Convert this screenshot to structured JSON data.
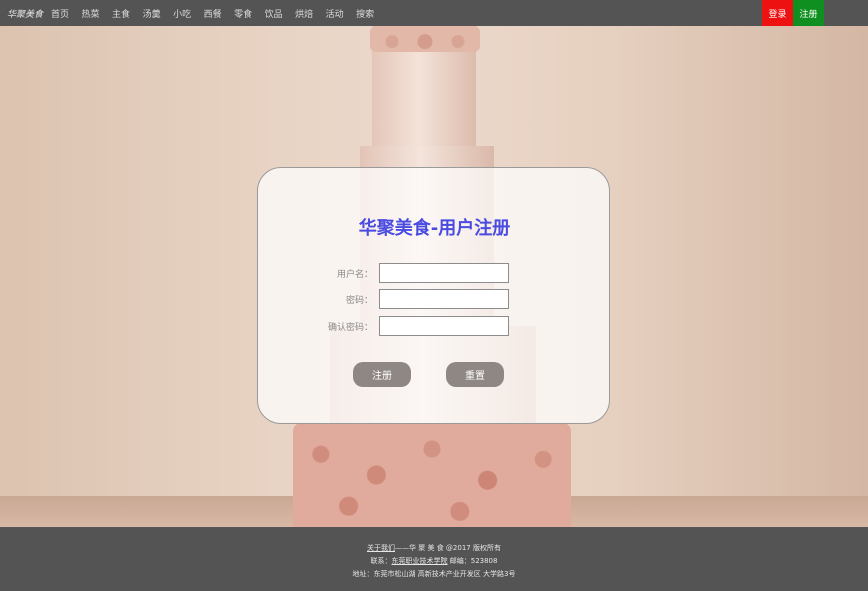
{
  "header": {
    "brand": "华聚美食",
    "nav": [
      "首页",
      "热菜",
      "主食",
      "汤羹",
      "小吃",
      "西餐",
      "零食",
      "饮品",
      "烘焙",
      "活动",
      "搜索"
    ],
    "login_label": "登录",
    "register_label": "注册"
  },
  "form": {
    "title": "华聚美食-用户注册",
    "username_label": "用户名：",
    "password_label": "密码：",
    "confirm_label": "确认密码：",
    "username_value": "",
    "password_value": "",
    "confirm_value": "",
    "submit_label": "注册",
    "reset_label": "重置"
  },
  "footer": {
    "about_link": "关于我们",
    "about_rest": "——华 聚 美 食 @2017 版权所有",
    "contact_prefix": "联系：",
    "contact_link": "东莞职业技术学院",
    "contact_rest": " 邮编：523808",
    "address": "地址：东莞市松山湖 高新技术产业开发区 大学路3号"
  },
  "colors": {
    "topbar": "#545454",
    "login": "#ee1111",
    "register": "#0f8f1f",
    "title": "#4a4be0",
    "button": "#8f8784"
  }
}
